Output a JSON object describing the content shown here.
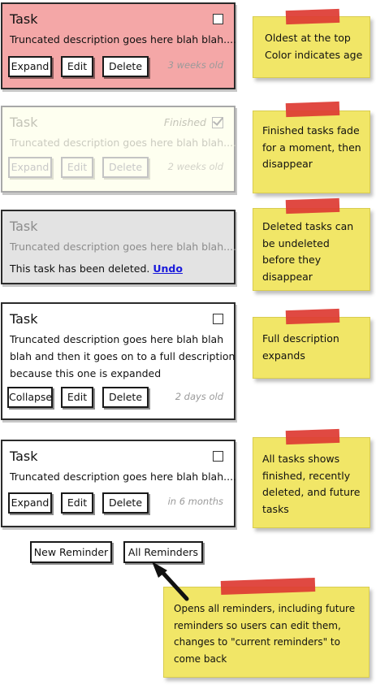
{
  "tasks": [
    {
      "title": "Task",
      "description": "Truncated description goes here blah blah....",
      "buttons": [
        "Expand",
        "Edit",
        "Delete"
      ],
      "age": "3 weeks old",
      "color": "#f4a7a7"
    },
    {
      "title": "Task",
      "status": "Finished",
      "description": "Truncated description goes here blah blah....",
      "buttons": [
        "Expand",
        "Edit",
        "Delete"
      ],
      "age": "2 weeks old",
      "color": "#fefff0"
    },
    {
      "title": "Task",
      "description": "Truncated description goes here blah blah....",
      "deleted_message": "This task has been deleted.",
      "undo_label": "Undo",
      "color": "#e3e3e3"
    },
    {
      "title": "Task",
      "description_lines": [
        "Truncated description goes here blah blah",
        "blah and then it goes on to a full description",
        "because this one is expanded"
      ],
      "buttons": [
        "Collapse",
        "Edit",
        "Delete"
      ],
      "age": "2 days old",
      "color": "#ffffff"
    },
    {
      "title": "Task",
      "description": "Truncated description goes here blah blah....",
      "buttons": [
        "Expand",
        "Edit",
        "Delete"
      ],
      "age": "in 6 months",
      "color": "#ffffff"
    }
  ],
  "bottom_buttons": [
    "New Reminder",
    "All Reminders"
  ],
  "notes": [
    [
      "Oldest at the top",
      "Color indicates age"
    ],
    [
      "Finished tasks fade",
      "for a moment, then",
      "disappear"
    ],
    [
      "Deleted tasks can",
      "be undeleted",
      "before they",
      "disappear"
    ],
    [
      "Full description",
      "expands"
    ],
    [
      "All tasks shows",
      "finished, recently",
      "deleted, and future",
      "tasks"
    ],
    [
      "Opens all reminders, including future",
      "reminders so users can edit them,",
      "changes to \"current reminders\" to",
      "come back"
    ]
  ],
  "colors": {
    "note_yellow": "#f1e667",
    "tape_red": "#de3b34",
    "old_task_pink": "#f4a7a7",
    "deleted_gray": "#e3e3e3",
    "undo_blue": "#1a1adb"
  }
}
